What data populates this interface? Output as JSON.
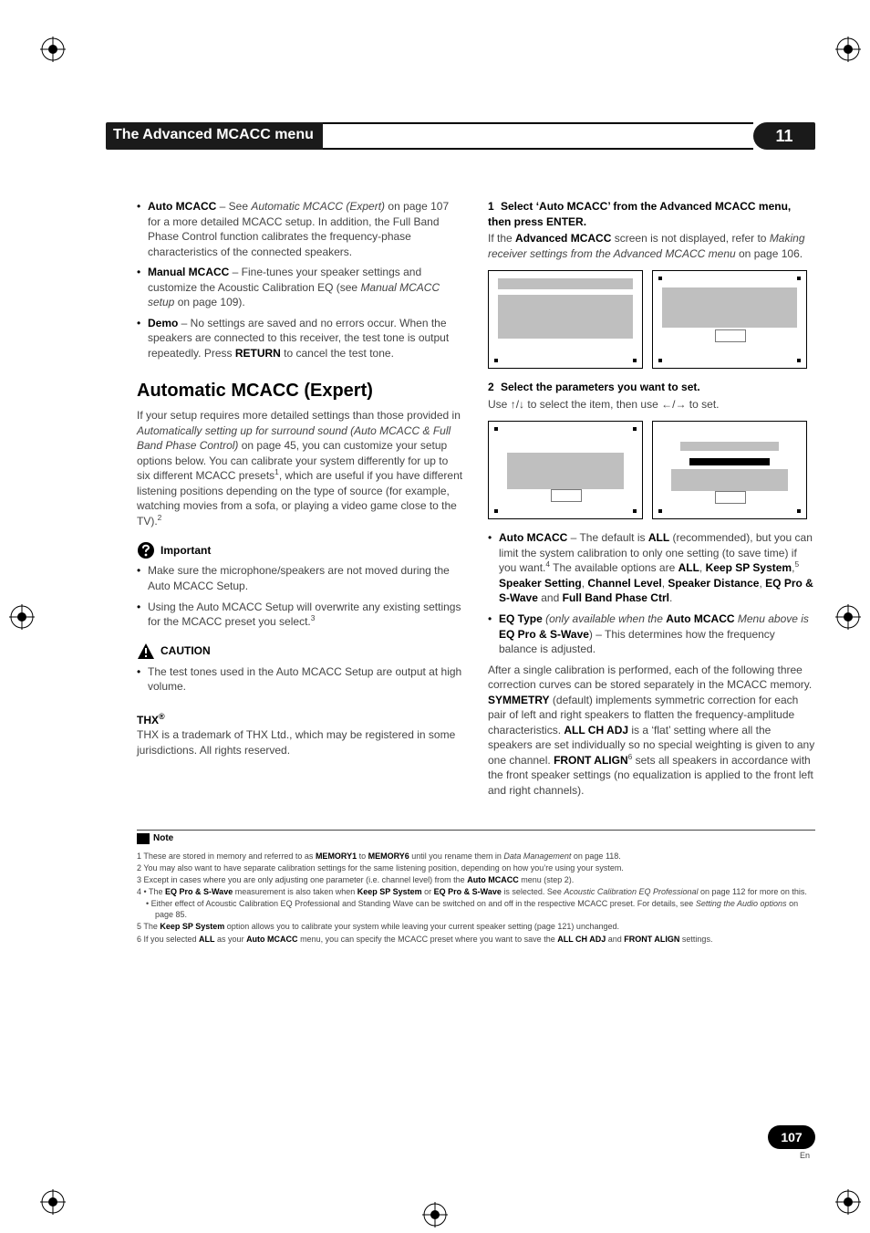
{
  "header": {
    "title": "The Advanced MCACC menu",
    "chapter": "11"
  },
  "left": {
    "bullets": {
      "b1_strong": "Auto MCACC",
      "b1_dash": " – See ",
      "b1_em": "Automatic MCACC (Expert)",
      "b1_rest": " on page 107 for a more detailed MCACC setup. In addition, the Full Band Phase Control function calibrates the frequency-phase characteristics of the connected speakers.",
      "b2_strong": "Manual MCACC",
      "b2_rest_a": " – Fine-tunes your speaker settings and customize the Acoustic Calibration EQ (see ",
      "b2_em": "Manual MCACC setup",
      "b2_rest_b": " on page 109).",
      "b3_strong": "Demo",
      "b3_rest_a": " – No settings are saved and no errors occur. When the speakers are connected to this receiver, the test tone is output repeatedly. Press ",
      "b3_strong2": "RETURN",
      "b3_rest_b": " to cancel the test tone."
    },
    "h2": "Automatic MCACC (Expert)",
    "intro_a": "If your setup requires more detailed settings than those provided in ",
    "intro_em": "Automatically setting up for surround sound (Auto MCACC & Full Band Phase Control)",
    "intro_b": " on page 45, you can customize your setup options below. You can calibrate your system differently for up to six different MCACC presets",
    "intro_c": ", which are useful if you have different listening positions depending on the type of source (for example, watching movies from a sofa, or playing a video game close to the TV).",
    "important_label": "Important",
    "imp_b1": "Make sure the microphone/speakers are not moved during the Auto MCACC Setup.",
    "imp_b2_a": "Using the Auto MCACC Setup will overwrite any existing settings for the MCACC preset you select.",
    "caution_label": "CAUTION",
    "caution_b1": "The test tones used in the Auto MCACC Setup are output at high volume.",
    "thx_label": "THX",
    "thx_text": "THX is a trademark of THX Ltd., which may be registered in some jurisdictions. All rights reserved."
  },
  "right": {
    "step1": "Select ‘Auto MCACC’ from the Advanced MCACC menu, then press ENTER.",
    "step1_num": "1",
    "step1_p_a": "If the ",
    "step1_p_strong": "Advanced MCACC",
    "step1_p_b": " screen is not displayed, refer to ",
    "step1_p_em": "Making receiver settings from the Advanced MCACC menu",
    "step1_p_c": " on page 106.",
    "step2_num": "2",
    "step2": "Select the parameters you want to set.",
    "step2_sub_a": "Use ",
    "step2_sub_b": " to select the item, then use ",
    "step2_sub_c": " to set.",
    "arrows_ud": "↑/↓",
    "arrows_lr": "←/→",
    "b1_strong": "Auto MCACC",
    "b1_a": " – The default is ",
    "b1_all": "ALL",
    "b1_b": " (recommended), but you can limit the system calibration to only one setting (to save time) if you want.",
    "b1_c": " The available options are ",
    "b1_opts_all": "ALL",
    "b1_sep": ", ",
    "b1_opts_keep": "Keep SP System",
    "b1_opts_spk": "Speaker Setting",
    "b1_opts_ch": "Channel Level",
    "b1_opts_dist": "Speaker Distance",
    "b1_opts_eq": "EQ Pro & S-Wave",
    "b1_and": " and ",
    "b1_opts_fbp": "Full Band Phase Ctrl",
    "b1_period": ".",
    "b2_strong": "EQ Type",
    "b2_em_a": " (only available when the ",
    "b2_strong2": "Auto MCACC",
    "b2_em_b": " Menu above is ",
    "b2_strong3": "EQ Pro & S-Wave",
    "b2_rest": ") – This determines how the frequency balance is adjusted.",
    "para_a": "After a single calibration is performed, each of the following three correction curves can be stored separately in the MCACC memory. ",
    "para_sym": "SYMMETRY",
    "para_b": " (default) implements symmetric correction for each pair of left and right speakers to flatten the frequency-amplitude characteristics. ",
    "para_all": "ALL CH ADJ",
    "para_c": " is a ‘flat’ setting where all the speakers are set individually so no special weighting is given to any one channel. ",
    "para_front": "FRONT ALIGN",
    "para_d": " sets all speakers in accordance with the front speaker settings (no equalization is applied to the front left and right channels)."
  },
  "notes": {
    "label": "Note",
    "n1_a": "1 These are stored in memory and referred to as ",
    "n1_m1": "MEMORY1",
    "n1_to": " to ",
    "n1_m6": "MEMORY6",
    "n1_b": " until you rename them in ",
    "n1_em": "Data Management",
    "n1_c": " on page 118.",
    "n2": "2 You may also want to have separate calibration settings for the same listening position, depending on how you’re using your system.",
    "n3_a": "3 Except in cases where you are only adjusting one parameter (i.e. channel level) from the ",
    "n3_strong": "Auto MCACC",
    "n3_b": " menu (step 2).",
    "n4_a": "4 • The ",
    "n4_s1": "EQ Pro & S-Wave",
    "n4_b": " measurement is also taken when ",
    "n4_s2": "Keep SP System",
    "n4_c": " or ",
    "n4_s3": "EQ Pro & S-Wave",
    "n4_d": " is selected. See ",
    "n4_em": "Acoustic Calibration EQ Professional",
    "n4_e": " on page 112 for more on this.",
    "n4s_a": "• Either effect of Acoustic Calibration EQ Professional and Standing Wave can be switched on and off in the respective MCACC preset. For details, see ",
    "n4s_em": "Setting the Audio options",
    "n4s_b": " on page 85.",
    "n5_a": "5 The ",
    "n5_s": "Keep SP System",
    "n5_b": " option allows you to calibrate your system while leaving your current speaker setting (page 121) unchanged.",
    "n6_a": "6 If you selected ",
    "n6_s1": "ALL",
    "n6_b": " as your ",
    "n6_s2": "Auto MCACC",
    "n6_c": " menu, you can specify the MCACC preset where you want to save the ",
    "n6_s3": "ALL CH ADJ",
    "n6_d": " and ",
    "n6_s4": "FRONT ALIGN",
    "n6_e": " settings."
  },
  "page": {
    "num": "107",
    "lang": "En"
  }
}
